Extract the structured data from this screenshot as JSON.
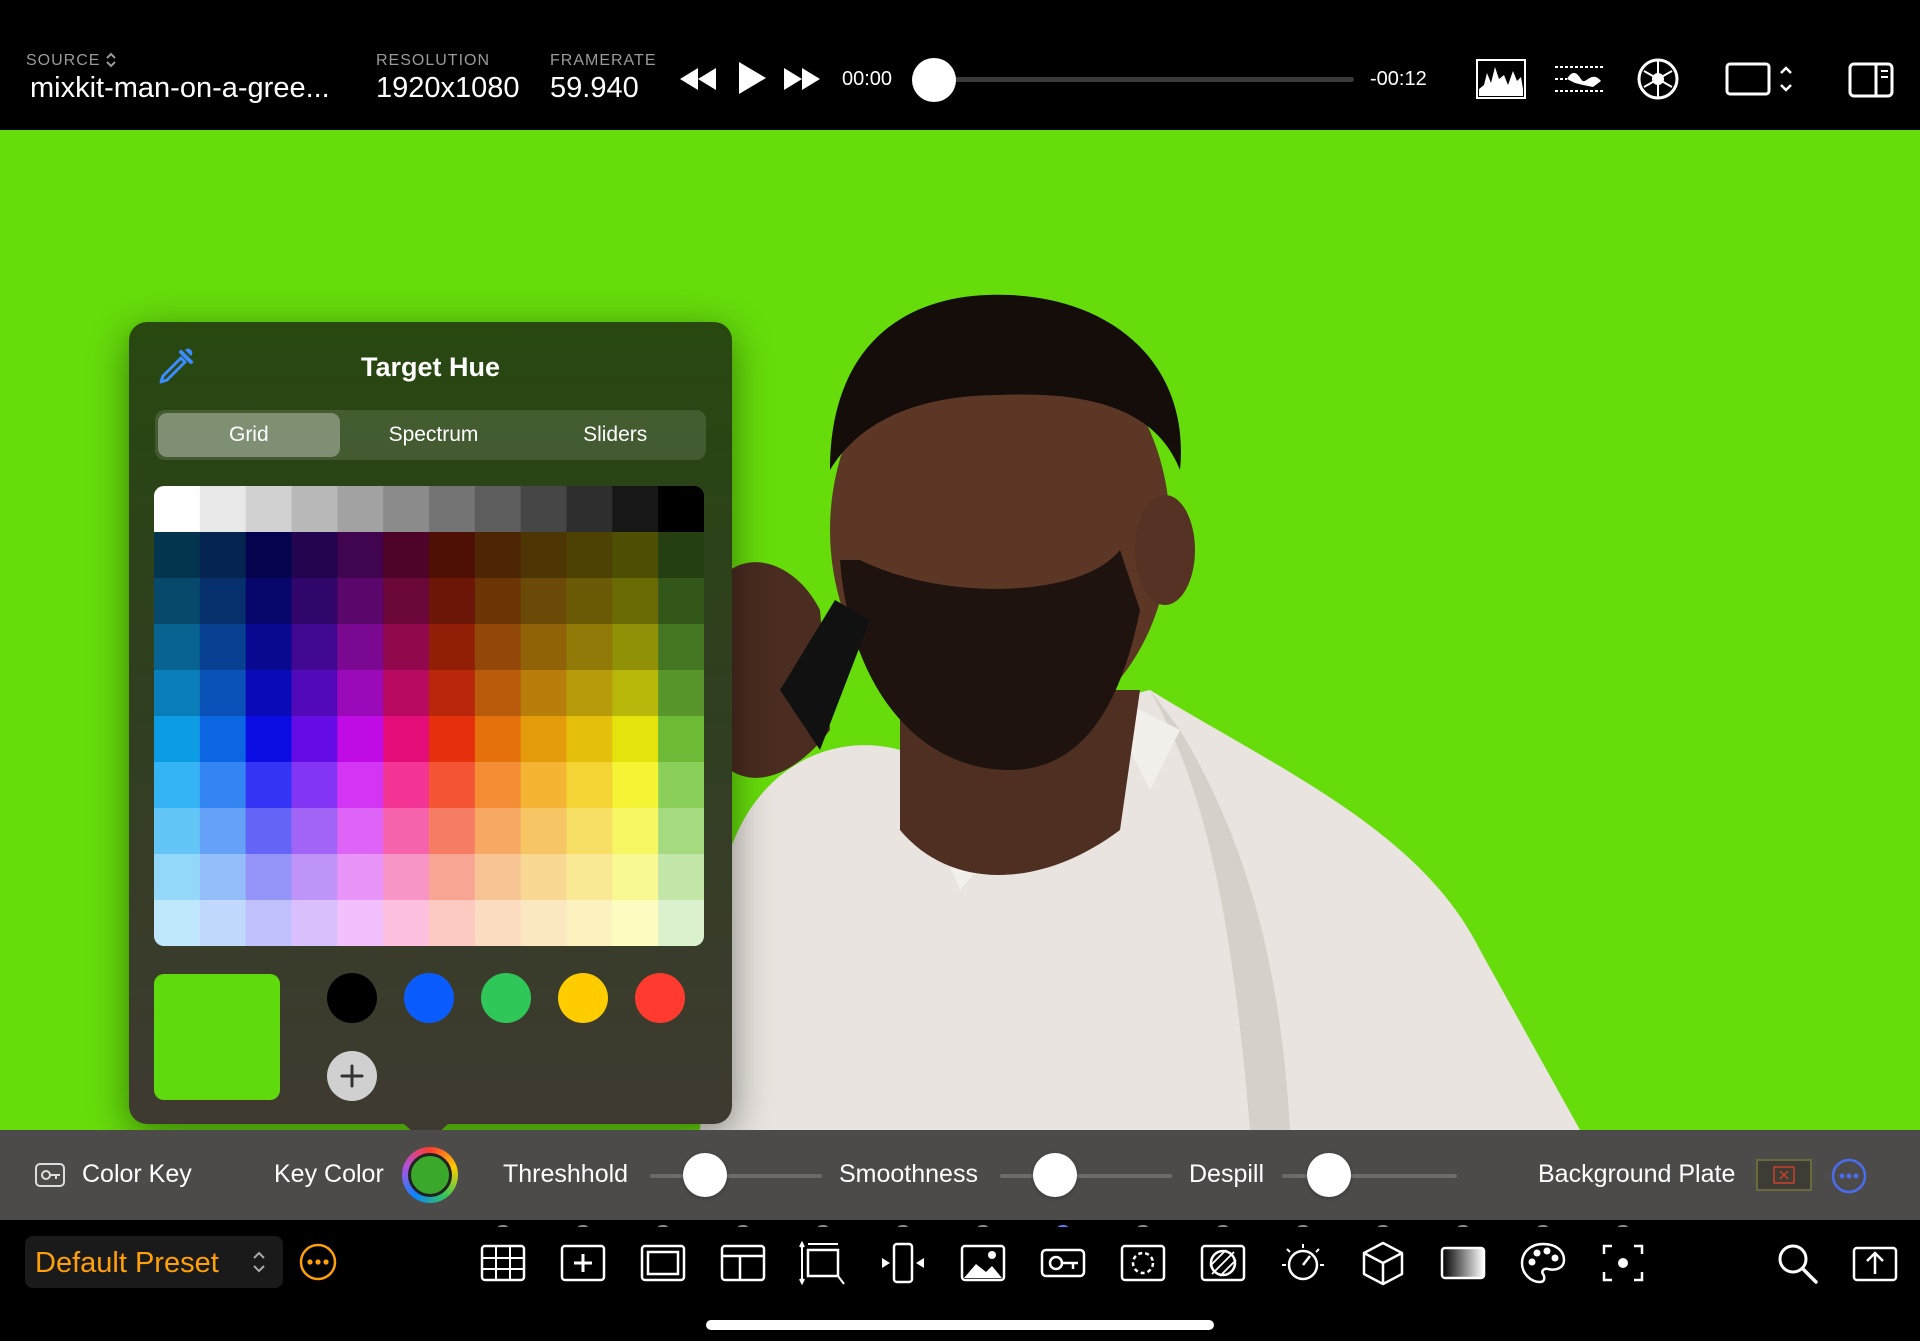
{
  "topbar": {
    "source_label": "SOURCE",
    "source_value": "mixkit-man-on-a-gree...",
    "resolution_label": "RESOLUTION",
    "resolution_value": "1920x1080",
    "framerate_label": "FRAMERATE",
    "framerate_value": "59.940",
    "time_current": "00:00",
    "time_remaining": "-00:12",
    "playhead_position": 0.0,
    "icons": [
      "rewind-icon",
      "play-icon",
      "fast-forward-icon",
      "histogram-icon",
      "waveform-icon",
      "vectorscope-icon",
      "aspect-ratio-icon",
      "sidebar-icon"
    ]
  },
  "viewer": {
    "background_color": "#66dd0b"
  },
  "target_hue": {
    "title": "Target Hue",
    "tabs": [
      {
        "label": "Grid",
        "active": true
      },
      {
        "label": "Spectrum",
        "active": false
      },
      {
        "label": "Sliders",
        "active": false
      }
    ],
    "selected_color": "#5fdb0d",
    "swatches": [
      "#000000",
      "#0a5cff",
      "#30c759",
      "#ffcc00",
      "#ff3b30"
    ],
    "add_label": "+"
  },
  "parameters": {
    "effect_label": "Color Key",
    "key_color_label": "Key Color",
    "key_color_value": "#3aa82a",
    "threshold_label": "Threshhold",
    "threshold_value": 0.32,
    "smoothness_label": "Smoothness",
    "smoothness_value": 0.32,
    "despill_label": "Despill",
    "despill_value": 0.27,
    "background_plate_label": "Background Plate"
  },
  "bottombar": {
    "preset_label": "Default Preset",
    "tools": [
      "grid-icon",
      "add-icon",
      "frame-icon",
      "layout-icon",
      "transform-icon",
      "flip-icon",
      "image-icon",
      "color-key-icon",
      "mask-icon",
      "exposure-icon",
      "dial-icon",
      "cube-icon",
      "gradient-icon",
      "palette-icon",
      "focus-icon"
    ],
    "active_tool": "color-key-icon",
    "right_icons": [
      "search-icon",
      "export-icon"
    ]
  }
}
